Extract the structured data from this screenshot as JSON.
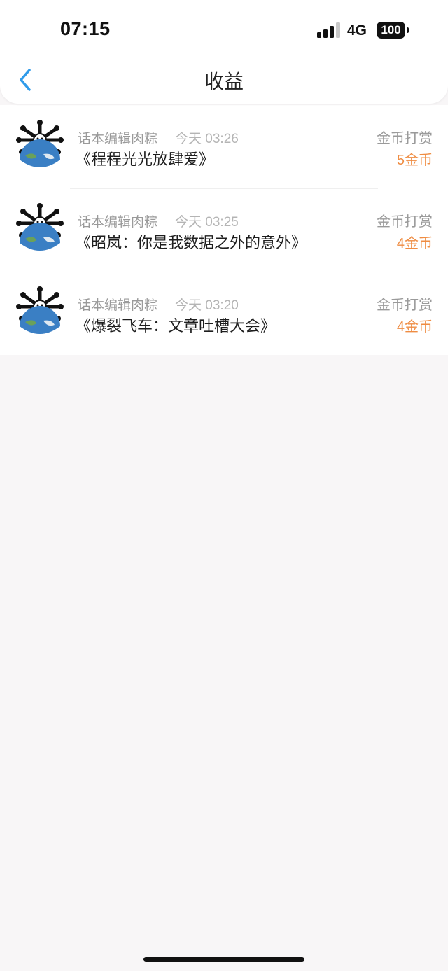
{
  "status_bar": {
    "time": "07:15",
    "network": "4G",
    "battery": "100"
  },
  "nav": {
    "title": "收益",
    "back_icon": "chevron-left-icon"
  },
  "colors": {
    "accent_blue": "#2f9bea",
    "amount_orange": "#ef8c42",
    "background": "#f8f6f7"
  },
  "records": [
    {
      "sender": "话本编辑肉粽",
      "time": "今天 03:26",
      "title": "《程程光光放肆爱》",
      "type": "金币打赏",
      "amount": "5金币",
      "avatar_icon": "earth-avatar-icon"
    },
    {
      "sender": "话本编辑肉粽",
      "time": "今天 03:25",
      "title": "《昭岚：你是我数据之外的意外》",
      "type": "金币打赏",
      "amount": "4金币",
      "avatar_icon": "earth-avatar-icon"
    },
    {
      "sender": "话本编辑肉粽",
      "time": "今天 03:20",
      "title": "《爆裂飞车：文章吐槽大会》",
      "type": "金币打赏",
      "amount": "4金币",
      "avatar_icon": "earth-avatar-icon"
    }
  ]
}
